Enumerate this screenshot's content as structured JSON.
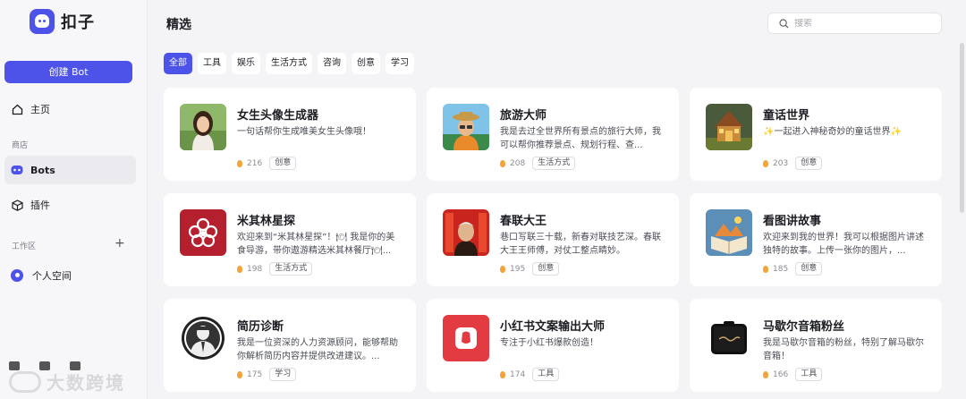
{
  "app": {
    "name": "扣子",
    "brand_color": "#4d53e8"
  },
  "sidebar": {
    "create_label": "创建 Bot",
    "home_label": "主页",
    "store_section": "商店",
    "bots_label": "Bots",
    "plugins_label": "插件",
    "workspace_section": "工作区",
    "personal_label": "个人空间"
  },
  "watermark": "大数跨境",
  "header": {
    "title": "精选",
    "search_placeholder": "搜索"
  },
  "tabs": [
    "全部",
    "工具",
    "娱乐",
    "生活方式",
    "咨询",
    "创意",
    "学习"
  ],
  "cards": [
    {
      "title": "女生头像生成器",
      "desc": "一句话帮你生成唯美女生头像哦！",
      "count": "216",
      "tag": "创意",
      "icon": "girl-portrait"
    },
    {
      "title": "旅游大师",
      "desc": "我是去过全世界所有景点的旅行大师，我可以帮你推荐景点、规划行程、查...",
      "count": "208",
      "tag": "生活方式",
      "icon": "traveler-portrait"
    },
    {
      "title": "童话世界",
      "desc": "✨一起进入神秘奇妙的童话世界✨",
      "count": "203",
      "tag": "创意",
      "icon": "fairy-house"
    },
    {
      "title": "米其林星探",
      "desc": "欢迎来到“米其林星探”！🍽 我是你的美食导游，带你遨游精选米其林餐厅🍽...",
      "count": "198",
      "tag": "生活方式",
      "icon": "michelin-flower"
    },
    {
      "title": "春联大王",
      "desc": "巷口写联三十载，新春对联技艺深。春联大王王师傅，对仗工整点睛妙。",
      "count": "195",
      "tag": "创意",
      "icon": "couplet-master"
    },
    {
      "title": "看图讲故事",
      "desc": "欢迎来到我的世界！我可以根据图片讲述独特的故事。上传一张你的图片，...",
      "count": "185",
      "tag": "创意",
      "icon": "storybook"
    },
    {
      "title": "简历诊断",
      "desc": "我是一位资深的人力资源顾问，能够帮助你解析简历内容并提供改进建议。...",
      "count": "175",
      "tag": "学习",
      "icon": "suit-silhouette"
    },
    {
      "title": "小红书文案输出大师",
      "desc": "专注于小红书爆款创造！",
      "count": "174",
      "tag": "工具",
      "icon": "red-note"
    },
    {
      "title": "马歇尔音箱粉丝",
      "desc": "我是马歇尔音箱的粉丝，特别了解马歇尔音箱！",
      "count": "166",
      "tag": "工具",
      "icon": "marshall-speaker"
    }
  ]
}
